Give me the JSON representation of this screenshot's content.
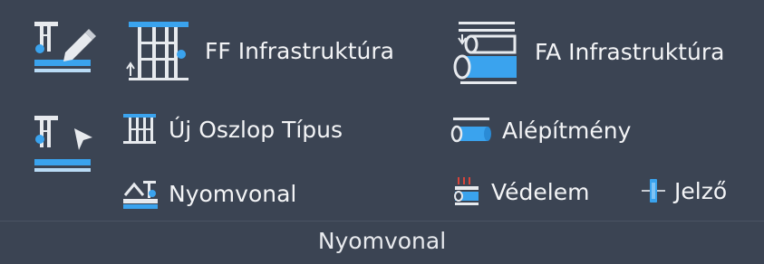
{
  "panel": {
    "title": "Nyomvonal"
  },
  "buttons": {
    "edit_route": {
      "icon": "route-edit-icon"
    },
    "select_route": {
      "icon": "route-select-icon"
    },
    "ff_infra": {
      "label": "FF Infrastruktúra",
      "icon": "tower-infrastructure-icon"
    },
    "fa_infra": {
      "label": "FA Infrastruktúra",
      "icon": "pipe-infrastructure-icon"
    },
    "new_pole_type": {
      "label": "Új Oszlop Típus",
      "icon": "pole-type-icon"
    },
    "route": {
      "label": "Nyomvonal",
      "icon": "route-icon"
    },
    "substructure": {
      "label": "Alépítmény",
      "icon": "conduit-icon"
    },
    "protection": {
      "label": "Védelem",
      "icon": "protection-icon"
    },
    "marker": {
      "label": "Jelző",
      "icon": "marker-icon"
    }
  },
  "colors": {
    "background": "#3b4453",
    "accent_blue": "#3aa3ee",
    "icon_light": "#e7eaee",
    "protection_red": "#d9443a"
  }
}
